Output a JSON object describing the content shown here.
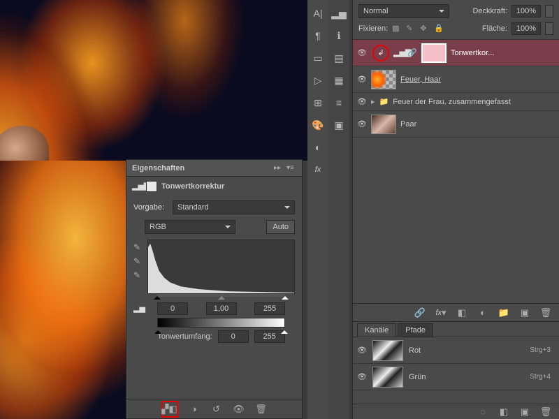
{
  "properties_panel": {
    "title": "Eigenschaften",
    "adjustment_name": "Tonwertkorrektur",
    "preset_label": "Vorgabe:",
    "preset_value": "Standard",
    "channel_value": "RGB",
    "auto_label": "Auto",
    "input_black": "0",
    "input_gamma": "1,00",
    "input_white": "255",
    "output_label": "Tonwertumfang:",
    "output_black": "0",
    "output_white": "255"
  },
  "layers_panel": {
    "blend_mode": "Normal",
    "opacity_label": "Deckkraft:",
    "opacity_value": "100%",
    "lock_label": "Fixieren:",
    "fill_label": "Fläche:",
    "fill_value": "100%",
    "layers": [
      {
        "name": "Tonwertkor...",
        "selected": true
      },
      {
        "name": "Feuer, Haar "
      },
      {
        "name": "Feuer der Frau, zusammengefasst"
      },
      {
        "name": "Paar"
      }
    ]
  },
  "channels_panel": {
    "tab_channels": "Kanäle",
    "tab_paths": "Pfade",
    "rows": [
      {
        "name": "Rot",
        "shortcut": "Strg+3"
      },
      {
        "name": "Grün",
        "shortcut": "Strg+4"
      }
    ]
  }
}
